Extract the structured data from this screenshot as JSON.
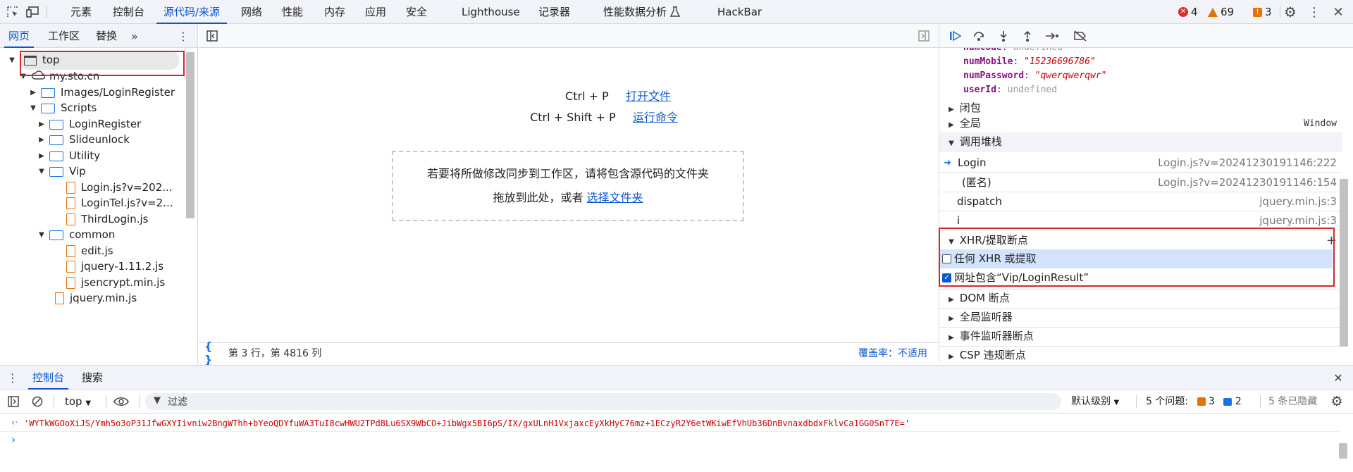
{
  "toolbar": {
    "tabs": [
      "元素",
      "控制台",
      "源代码/来源",
      "网络",
      "性能",
      "内存",
      "应用",
      "安全",
      "Lighthouse",
      "记录器",
      "性能数据分析",
      "HackBar"
    ],
    "errors": "4",
    "warnings": "69",
    "issues": "3"
  },
  "left": {
    "tabs": [
      "网页",
      "工作区",
      "替换"
    ],
    "tree": [
      {
        "label": "top",
        "kind": "frame",
        "open": true
      },
      {
        "label": "my.sto.cn",
        "kind": "cloud",
        "open": true
      },
      {
        "label": "Images/LoginRegister",
        "kind": "folder",
        "open": false
      },
      {
        "label": "Scripts",
        "kind": "folder",
        "open": true
      },
      {
        "label": "LoginRegister",
        "kind": "folder",
        "open": false
      },
      {
        "label": "Slideunlock",
        "kind": "folder",
        "open": false
      },
      {
        "label": "Utility",
        "kind": "folder",
        "open": false
      },
      {
        "label": "Vip",
        "kind": "folder",
        "open": true
      },
      {
        "label": "Login.js?v=202...",
        "kind": "file"
      },
      {
        "label": "LoginTel.js?v=2...",
        "kind": "file"
      },
      {
        "label": "ThirdLogin.js",
        "kind": "file"
      },
      {
        "label": "common",
        "kind": "folder",
        "open": true
      },
      {
        "label": "edit.js",
        "kind": "file"
      },
      {
        "label": "jquery-1.11.2.js",
        "kind": "file"
      },
      {
        "label": "jsencrypt.min.js",
        "kind": "file"
      },
      {
        "label": "jquery.min.js",
        "kind": "file"
      }
    ]
  },
  "center": {
    "shortcut1_keys": "Ctrl + P",
    "shortcut1_action": "打开文件",
    "shortcut2_keys": "Ctrl + Shift + P",
    "shortcut2_action": "运行命令",
    "drop_line1": "若要将所做修改同步到工作区，请将包含源代码的文件夹",
    "drop_line2": "拖放到此处，或者",
    "drop_link": "选择文件夹",
    "status_position": "第 3 行，第 4816 列",
    "coverage": "覆盖率：不适用"
  },
  "right": {
    "scope_vars": [
      {
        "name": "numCode",
        "value": "undefined"
      },
      {
        "name": "numMobile",
        "value": "\"15236696786\""
      },
      {
        "name": "numPassword",
        "value": "\"qwerqwerqwr\""
      },
      {
        "name": "userId",
        "value": "undefined"
      }
    ],
    "closure_label": "闭包",
    "global_label": "全局",
    "global_value": "Window",
    "callstack_label": "调用堆栈",
    "callstack": [
      {
        "fn": "Login",
        "loc": "Login.js?v=20241230191146:222",
        "current": true
      },
      {
        "fn": "(匿名)",
        "loc": "Login.js?v=20241230191146:154"
      },
      {
        "fn": "dispatch",
        "loc": "jquery.min.js:3"
      },
      {
        "fn": "i",
        "loc": "jquery.min.js:3"
      }
    ],
    "xhr_label": "XHR/提取断点",
    "xhr_items": [
      {
        "label": "任何 XHR 或提取",
        "checked": false
      },
      {
        "label": "网址包含“Vip/LoginResult”",
        "checked": true
      }
    ],
    "sections": [
      "DOM 断点",
      "全局监听器",
      "事件监听器断点",
      "CSP 违规断点"
    ]
  },
  "drawer": {
    "tabs": [
      "控制台",
      "搜索"
    ],
    "context": "top",
    "filter_placeholder": "过滤",
    "level": "默认级别",
    "issues_label": "5 个问题:",
    "issues_warn": "3",
    "issues_info": "2",
    "hidden": "5 条已隐藏",
    "output": "'WYTkWGOoXiJS/Ymh5o3oP31JfwGXYIivniw2BngWThh+bYeoQDYfuWA3TuI8cwHWU2TPd8Lu6SX9WbCO+JibWgx5BI6pS/IX/gxULnH1VxjaxcEyXkHyC76mz+1ECzyR2Y6etWKiwEfVhUb36DnBvnaxdbdxFklvCa1GG0SnT7E='"
  },
  "colors": {
    "accent": "#0b57d0",
    "highlight": "#d9252c",
    "string": "#c80000",
    "varname": "#881280"
  }
}
